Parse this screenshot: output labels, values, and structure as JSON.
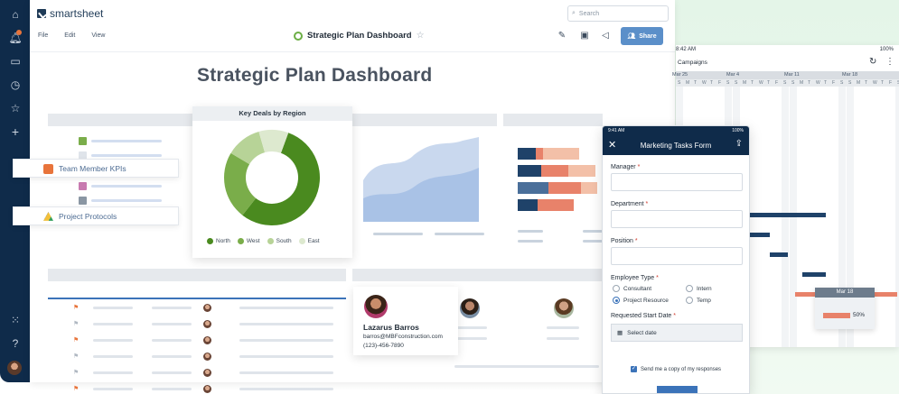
{
  "app": {
    "name": "smartsheet"
  },
  "rail": {
    "icons": [
      "home-icon",
      "bell-icon",
      "folder-icon",
      "clock-icon",
      "star-icon",
      "plus-icon",
      "grid-icon",
      "help-icon",
      "avatar"
    ]
  },
  "header": {
    "search_placeholder": "Search",
    "menu": [
      "File",
      "Edit",
      "View"
    ],
    "doc_title": "Strategic Plan Dashboard",
    "share_label": "Share"
  },
  "dashboard": {
    "title": "Strategic Plan Dashboard",
    "chips": [
      {
        "label": "Team Member KPIs",
        "icon": "sheet-icon",
        "color": "#e8743b"
      },
      {
        "label": "Project Protocols",
        "icon": "drive-icon",
        "color": "#3b73b9"
      }
    ],
    "key_deals": {
      "title": "Key Deals by Region"
    },
    "contact": {
      "name": "Lazarus Barros",
      "email": "barros@MBFconstruction.com",
      "phone": "(123)-456-7890"
    }
  },
  "chart_data": {
    "type": "pie",
    "title": "Key Deals by Region",
    "categories": [
      "North",
      "West",
      "South",
      "East"
    ],
    "values": [
      55,
      23,
      12,
      10
    ],
    "colors": [
      "#4a8a1f",
      "#7aad4a",
      "#b7d397",
      "#dde9cf"
    ],
    "legend": "bottom",
    "donut": true
  },
  "gantt": {
    "status_time": "8:42 AM",
    "battery": "100%",
    "title": "Campaigns",
    "months": [
      "Mar 25",
      "Mar 4",
      "Mar 11",
      "Mar 18"
    ],
    "day_letters": [
      "S",
      "M",
      "T",
      "W",
      "T",
      "F",
      "S",
      "S",
      "M",
      "T",
      "W",
      "T",
      "F",
      "S",
      "S",
      "M",
      "T",
      "W",
      "T",
      "F",
      "S",
      "S",
      "M",
      "T",
      "W",
      "T",
      "F",
      "S"
    ],
    "tooltip": {
      "month": "Mar 18",
      "percent": "50%",
      "progress": 0.5
    }
  },
  "form": {
    "status_time": "9:41 AM",
    "battery": "100%",
    "title": "Marketing Tasks Form",
    "manager_label": "Manager",
    "department_label": "Department",
    "position_label": "Position",
    "employee_type_label": "Employee Type",
    "options": [
      "Consultant",
      "Intern",
      "Project Resource",
      "Temp"
    ],
    "selected_option": "Project Resource",
    "start_date_label": "Requested Start Date",
    "date_placeholder": "Select date",
    "copy_label": "Send me a copy of my responses",
    "required_mark": "*"
  }
}
